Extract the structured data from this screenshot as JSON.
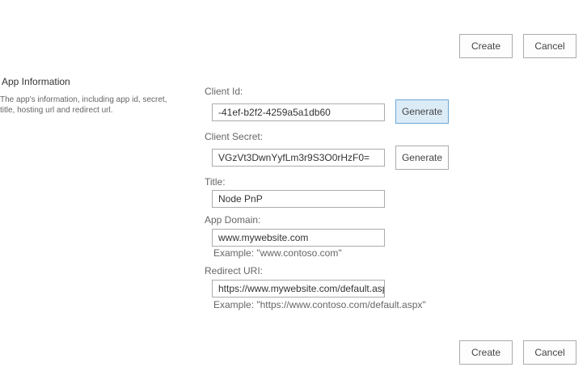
{
  "top_actions": {
    "create_label": "Create",
    "cancel_label": "Cancel"
  },
  "bottom_actions": {
    "create_label": "Create",
    "cancel_label": "Cancel"
  },
  "section": {
    "title": "App Information",
    "description_line1": "The app's information, including app id, secret,",
    "description_line2": "title, hosting url and redirect url."
  },
  "fields": {
    "client_id": {
      "label": "Client Id:",
      "value": "-41ef-b2f2-4259a5a1db60",
      "generate_label": "Generate"
    },
    "client_secret": {
      "label": "Client Secret:",
      "value": "VGzVt3DwnYyfLm3r9S3O0rHzF0=",
      "generate_label": "Generate"
    },
    "title": {
      "label": "Title:",
      "value": "Node PnP"
    },
    "app_domain": {
      "label": "App Domain:",
      "value": "www.mywebsite.com",
      "example": "Example: \"www.contoso.com\""
    },
    "redirect_uri": {
      "label": "Redirect URI:",
      "value": "https://www.mywebsite.com/default.aspx",
      "example": "Example: \"https://www.contoso.com/default.aspx\""
    }
  },
  "colors": {
    "button_border": "#ababab",
    "focused_button_bg": "#dcecf7",
    "focused_button_border": "#6aa6d6",
    "label_text": "#666666"
  }
}
